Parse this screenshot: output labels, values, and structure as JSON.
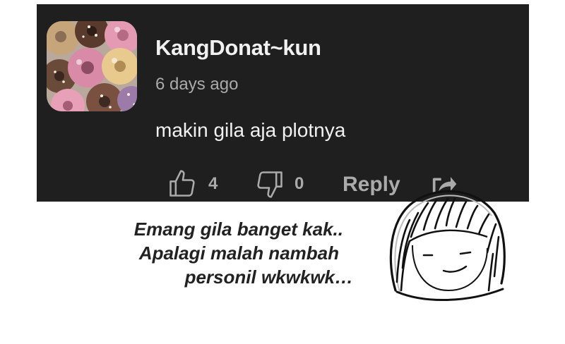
{
  "comment": {
    "username": "KangDonat~kun",
    "timestamp": "6 days ago",
    "text": "makin gila aja plotnya",
    "like_count": "4",
    "dislike_count": "0",
    "reply_label": "Reply"
  },
  "caption": {
    "line1": "Emang gila banget kak..",
    "line2": "Apalagi malah nambah",
    "line3": "personil wkwkwk…"
  },
  "icons": {
    "like": "thumb-up-icon",
    "dislike": "thumb-down-icon",
    "share": "share-icon"
  },
  "colors": {
    "card_background": "#1f1f1f",
    "primary_text": "#f1f1f1",
    "secondary_text": "#aaaaaa",
    "caption_text": "#222222"
  }
}
